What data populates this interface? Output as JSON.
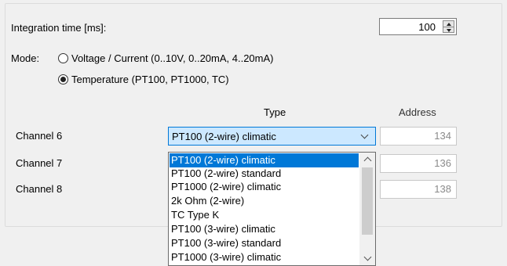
{
  "integration": {
    "label": "Integration time [ms]:",
    "value": "100"
  },
  "mode": {
    "label": "Mode:",
    "options": [
      {
        "label": "Voltage / Current (0..10V, 0..20mA, 4..20mA)",
        "checked": false
      },
      {
        "label": "Temperature (PT100, PT1000, TC)",
        "checked": true
      }
    ]
  },
  "table": {
    "type_header": "Type",
    "address_header": "Address",
    "rows": [
      {
        "channel": "Channel 6",
        "type": "PT100 (2-wire) climatic",
        "address": "134"
      },
      {
        "channel": "Channel 7",
        "type": "",
        "address": "136"
      },
      {
        "channel": "Channel 8",
        "type": "",
        "address": "138"
      }
    ]
  },
  "dropdown": {
    "items": [
      "PT100 (2-wire) climatic",
      "PT100 (2-wire) standard",
      "PT1000 (2-wire) climatic",
      "2k Ohm (2-wire)",
      "TC Type K",
      "PT100 (3-wire) climatic",
      "PT100 (3-wire) standard",
      "PT1000 (3-wire) climatic"
    ],
    "selected_index": 0
  },
  "colors": {
    "accent": "#0078d7",
    "combo_highlight": "#cce8ff",
    "background": "#f0f0f0"
  },
  "icons": {
    "spin": "up-down-arrows",
    "combo": "chevron-down",
    "scroll_up": "caret-up",
    "scroll_down": "caret-down",
    "radio": "radio-button"
  }
}
